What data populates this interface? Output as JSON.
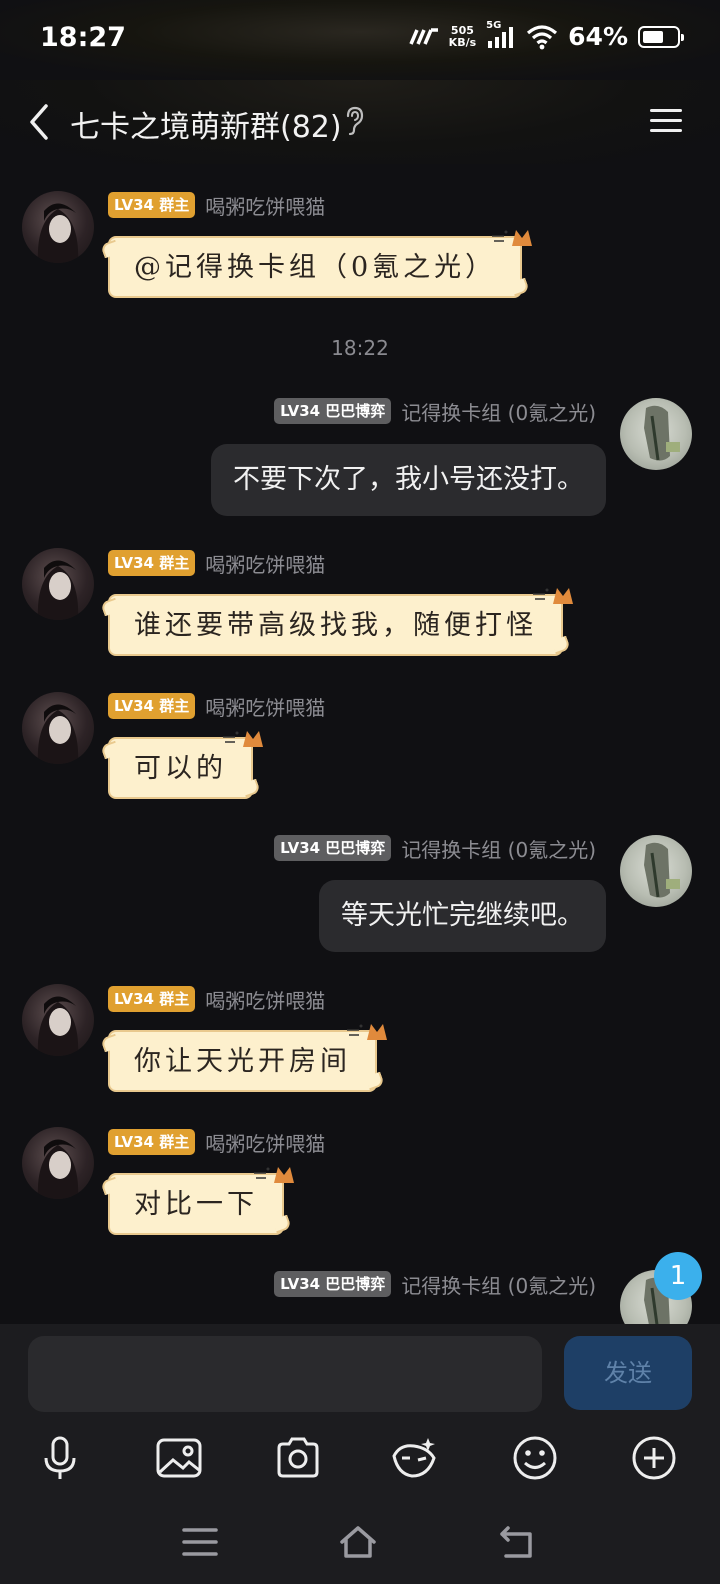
{
  "status_bar": {
    "time": "18:27",
    "net_speed_value": "505",
    "net_speed_unit": "KB/s",
    "network_type": "5G",
    "battery_percent": "64%",
    "battery_level": 0.64
  },
  "header": {
    "title": "七卡之境萌新群(82)",
    "icons": [
      "back-arrow-icon",
      "ear-icon",
      "menu-icon"
    ]
  },
  "messages": [
    {
      "side": "left",
      "badge": "LV34 群主",
      "name": "喝粥吃饼喂猫",
      "text": "@记得换卡组（0氪之光）"
    },
    {
      "type": "time",
      "text": "18:22"
    },
    {
      "side": "right",
      "badge": "LV34 巴巴博弈",
      "name": "记得换卡组 (0氪之光)",
      "text": "不要下次了，我小号还没打。"
    },
    {
      "side": "left",
      "badge": "LV34 群主",
      "name": "喝粥吃饼喂猫",
      "text": "谁还要带高级找我，随便打怪"
    },
    {
      "side": "left",
      "badge": "LV34 群主",
      "name": "喝粥吃饼喂猫",
      "text": "可以的"
    },
    {
      "side": "right",
      "badge": "LV34 巴巴博弈",
      "name": "记得换卡组 (0氪之光)",
      "text": "等天光忙完继续吧。"
    },
    {
      "side": "left",
      "badge": "LV34 群主",
      "name": "喝粥吃饼喂猫",
      "text": "你让天光开房间"
    },
    {
      "side": "left",
      "badge": "LV34 群主",
      "name": "喝粥吃饼喂猫",
      "text": "对比一下"
    },
    {
      "side": "right",
      "badge": "LV34 巴巴博弈",
      "name": "记得换卡组 (0氪之光)",
      "text": ""
    }
  ],
  "unread_count": "1",
  "input": {
    "placeholder": "",
    "send_label": "发送"
  },
  "toolbar_icons": [
    "microphone-icon",
    "image-icon",
    "camera-icon",
    "sticker-icon",
    "emoji-icon",
    "plus-icon"
  ],
  "nav_icons": [
    "recent-apps-icon",
    "home-icon",
    "back-icon"
  ]
}
